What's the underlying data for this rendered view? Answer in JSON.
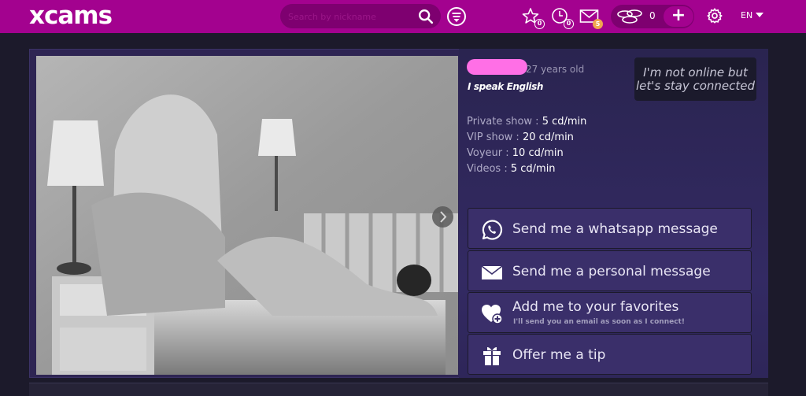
{
  "header": {
    "logo": "xcams",
    "search_placeholder": "Search by nickname",
    "favorites_count": "0",
    "history_count": "0",
    "messages_count": "5",
    "credits": "0",
    "add_credits_label": "+",
    "language": "EN",
    "accent_color": "#a3028f"
  },
  "profile": {
    "name": "",
    "age": "27 years old",
    "languages": "I speak English",
    "status": "I'm not online but let's stay connected",
    "rates": [
      {
        "label": "Private show : ",
        "value": "5 cd/min"
      },
      {
        "label": "VIP show : ",
        "value": "20 cd/min"
      },
      {
        "label": "Voyeur : ",
        "value": "10 cd/min"
      },
      {
        "label": "Videos : ",
        "value": "5 cd/min"
      }
    ]
  },
  "actions": [
    {
      "icon": "whatsapp-icon",
      "label": "Send me a whatsapp message"
    },
    {
      "icon": "envelope-icon",
      "label": "Send me a personal message"
    },
    {
      "icon": "heart-plus-icon",
      "label": "Add me to your favorites",
      "sub": "I'll send you an email as soon as I connect!"
    },
    {
      "icon": "gift-icon",
      "label": "Offer me a tip"
    }
  ]
}
